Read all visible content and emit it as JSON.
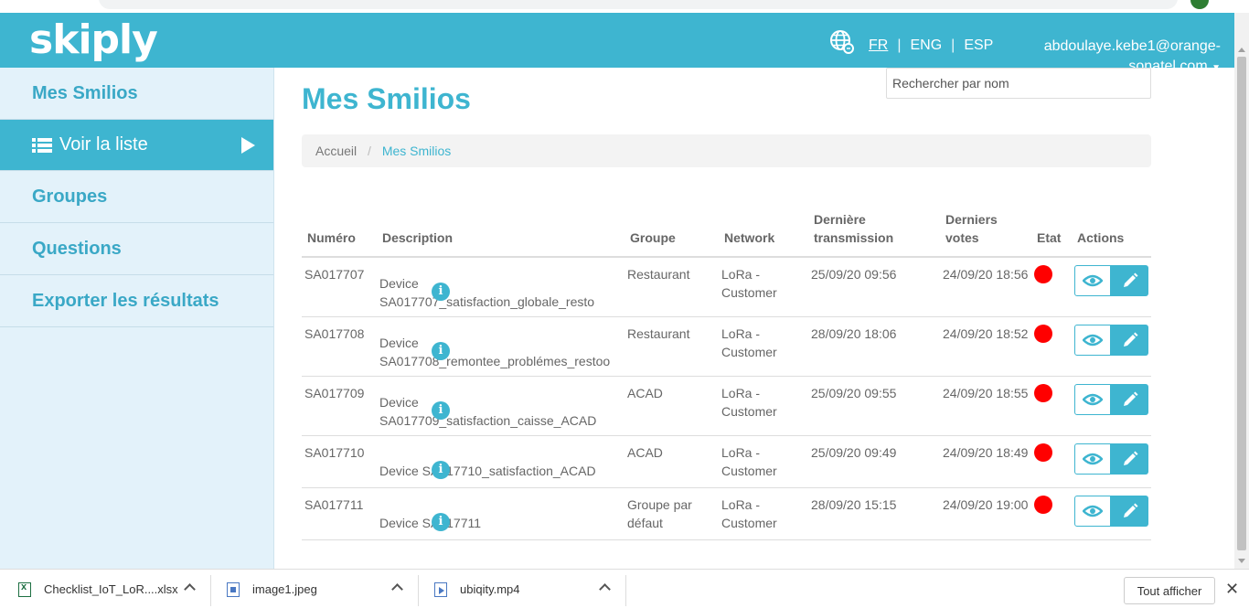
{
  "header": {
    "logo": "skiply",
    "languages": [
      "FR",
      "ENG",
      "ESP"
    ],
    "active_language": "FR",
    "user": "abdoulaye.kebe1@orange-sonatel.com",
    "accent_color": "#3eb5d0"
  },
  "sidebar": {
    "items": [
      {
        "label": "Mes Smilios"
      },
      {
        "label": "Voir la liste",
        "icon": "list-icon",
        "active": true
      },
      {
        "label": "Groupes"
      },
      {
        "label": "Questions"
      },
      {
        "label": "Exporter les résultats"
      }
    ]
  },
  "main": {
    "title": "Mes Smilios",
    "search_placeholder": "Rechercher par nom",
    "breadcrumb": [
      "Accueil",
      "Mes Smilios"
    ]
  },
  "table": {
    "columns": [
      "Numéro",
      "Description",
      "Groupe",
      "Network",
      "Dernière transmission",
      "Derniers votes",
      "Etat",
      "Actions"
    ],
    "rows": [
      {
        "num": "SA017707",
        "desc": "Device SA017707_satisfaction_globale_resto",
        "group": "Restaurant",
        "network": "LoRa - Customer",
        "last_tx": "25/09/20 09:56",
        "last_votes": "24/09/20 18:56",
        "state_color": "#ff0000"
      },
      {
        "num": "SA017708",
        "desc": "Device SA017708_remontee_problémes_restoo",
        "group": "Restaurant",
        "network": "LoRa - Customer",
        "last_tx": "28/09/20 18:06",
        "last_votes": "24/09/20 18:52",
        "state_color": "#ff0000"
      },
      {
        "num": "SA017709",
        "desc": "Device SA017709_satisfaction_caisse_ACAD",
        "group": "ACAD",
        "network": "LoRa - Customer",
        "last_tx": "25/09/20 09:55",
        "last_votes": "24/09/20 18:55",
        "state_color": "#ff0000"
      },
      {
        "num": "SA017710",
        "desc": "Device SA017710_satisfaction_ACAD",
        "group": "ACAD",
        "network": "LoRa - Customer",
        "last_tx": "25/09/20 09:49",
        "last_votes": "24/09/20 18:49",
        "state_color": "#ff0000"
      },
      {
        "num": "SA017711",
        "desc": "Device SA017711",
        "group": "Groupe par défaut",
        "network": "LoRa - Customer",
        "last_tx": "28/09/20 15:15",
        "last_votes": "24/09/20 19:00",
        "state_color": "#ff0000"
      }
    ]
  },
  "downloads": {
    "items": [
      {
        "name": "Checklist_IoT_LoR....xlsx",
        "icon": "excel-file-icon"
      },
      {
        "name": "image1.jpeg",
        "icon": "image-file-icon"
      },
      {
        "name": "ubiqity.mp4",
        "icon": "video-file-icon"
      }
    ],
    "show_all": "Tout afficher",
    "close": "✕"
  }
}
